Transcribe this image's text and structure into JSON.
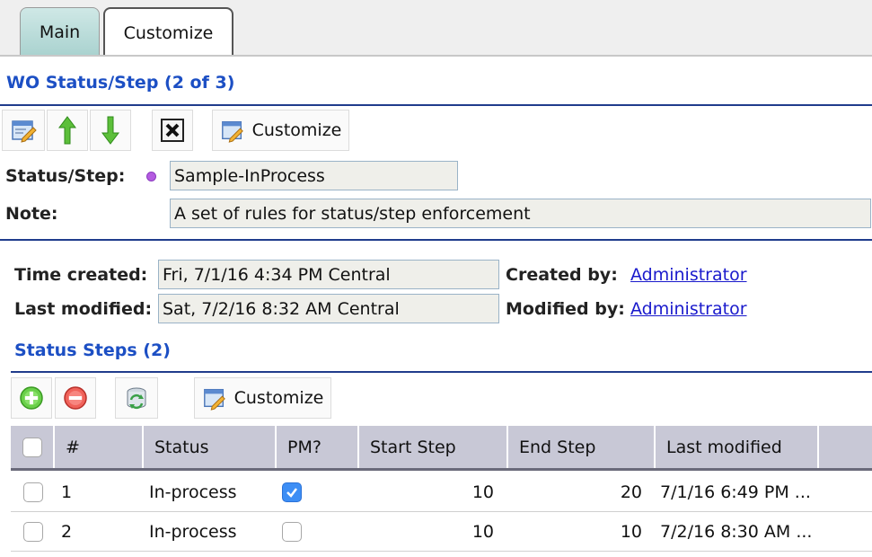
{
  "tabs": [
    {
      "label": "Main",
      "active": true
    },
    {
      "label": "Customize",
      "active": false
    }
  ],
  "section1": {
    "title": "WO Status/Step (2 of 3)",
    "toolbar": {
      "customize_label": "Customize",
      "icons": [
        "edit-icon",
        "move-up-icon",
        "move-down-icon",
        "delete-icon",
        "customize-icon"
      ]
    },
    "status_step_label": "Status/Step:",
    "status_step_value": "Sample-InProcess",
    "note_label": "Note:",
    "note_value": "A set of rules for status/step enforcement"
  },
  "meta": {
    "time_created_label": "Time created:",
    "time_created_value": "Fri, 7/1/16 4:34 PM Central",
    "last_modified_label": "Last modified:",
    "last_modified_value": "Sat, 7/2/16 8:32 AM Central",
    "created_by_label": "Created by:",
    "created_by_value": "Administrator",
    "modified_by_label": "Modified by:",
    "modified_by_value": "Administrator"
  },
  "steps": {
    "title": "Status Steps (2)",
    "toolbar": {
      "customize_label": "Customize",
      "icons": [
        "add-icon",
        "remove-icon",
        "refresh-icon",
        "customize-icon"
      ]
    },
    "columns": [
      "#",
      "Status",
      "PM?",
      "Start Step",
      "End Step",
      "Last modified"
    ],
    "rows": [
      {
        "num": "1",
        "status": "In-process",
        "pm": true,
        "start": "10",
        "end": "20",
        "modified": "7/1/16 6:49 PM ..."
      },
      {
        "num": "2",
        "status": "In-process",
        "pm": false,
        "start": "10",
        "end": "10",
        "modified": "7/2/16 8:30 AM ..."
      }
    ]
  },
  "colors": {
    "accent": "#1c4fc4",
    "rule": "#203c8c",
    "link": "#1a1acc",
    "tab_active": "#a9d2cf",
    "grid_header": "#c8c8d6"
  }
}
